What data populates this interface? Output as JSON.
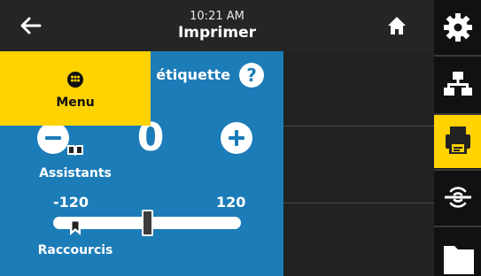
{
  "header": {
    "time": "10:21 AM",
    "title": "Imprimer",
    "back_icon": "arrow-left-icon",
    "home_icon": "home-icon"
  },
  "setting": {
    "title": "Décalage vertical étiquette",
    "help_label": "?",
    "value": "0",
    "range_min": "-120",
    "range_max": "120",
    "slider_value": 0,
    "minus_icon": "minus-circle-icon",
    "plus_icon": "plus-circle-icon"
  },
  "menu": {
    "items": [
      {
        "label": "Menu",
        "icon": "menu-dots-icon",
        "active": true
      },
      {
        "label": "Assistants",
        "icon": "book-open-icon",
        "active": false
      },
      {
        "label": "Raccourcis",
        "icon": "bookmark-icon",
        "active": false
      }
    ]
  },
  "rail": {
    "items": [
      {
        "icon": "gear-icon",
        "active": false
      },
      {
        "icon": "network-icon",
        "active": false
      },
      {
        "icon": "printer-icon",
        "active": true
      },
      {
        "icon": "wireless-sensor-icon",
        "active": false
      },
      {
        "icon": "folder-icon",
        "active": false
      }
    ]
  },
  "colors": {
    "panel_blue": "#1c7cb8",
    "accent_yellow": "#ffd200",
    "dark": "#222222"
  }
}
